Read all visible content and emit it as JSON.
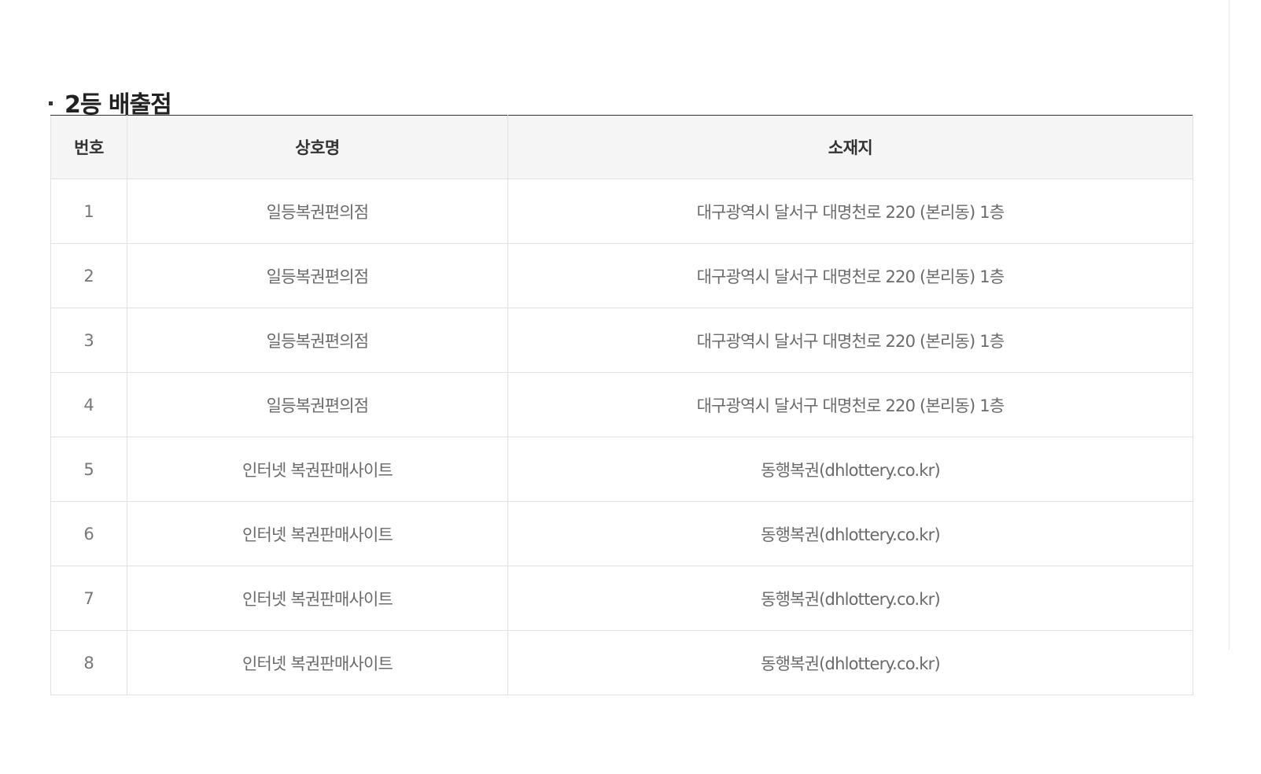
{
  "section": {
    "title": "2등 배출점"
  },
  "table": {
    "headers": {
      "no": "번호",
      "name": "상호명",
      "address": "소재지"
    },
    "rows": [
      {
        "no": "1",
        "name": "일등복권편의점",
        "address": "대구광역시 달서구 대명천로 220 (본리동) 1층"
      },
      {
        "no": "2",
        "name": "일등복권편의점",
        "address": "대구광역시 달서구 대명천로 220 (본리동) 1층"
      },
      {
        "no": "3",
        "name": "일등복권편의점",
        "address": "대구광역시 달서구 대명천로 220 (본리동) 1층"
      },
      {
        "no": "4",
        "name": "일등복권편의점",
        "address": "대구광역시 달서구 대명천로 220 (본리동) 1층"
      },
      {
        "no": "5",
        "name": "인터넷 복권판매사이트",
        "address": "동행복권(dhlottery.co.kr)"
      },
      {
        "no": "6",
        "name": "인터넷 복권판매사이트",
        "address": "동행복권(dhlottery.co.kr)"
      },
      {
        "no": "7",
        "name": "인터넷 복권판매사이트",
        "address": "동행복권(dhlottery.co.kr)"
      },
      {
        "no": "8",
        "name": "인터넷 복권판매사이트",
        "address": "동행복권(dhlottery.co.kr)"
      }
    ]
  }
}
